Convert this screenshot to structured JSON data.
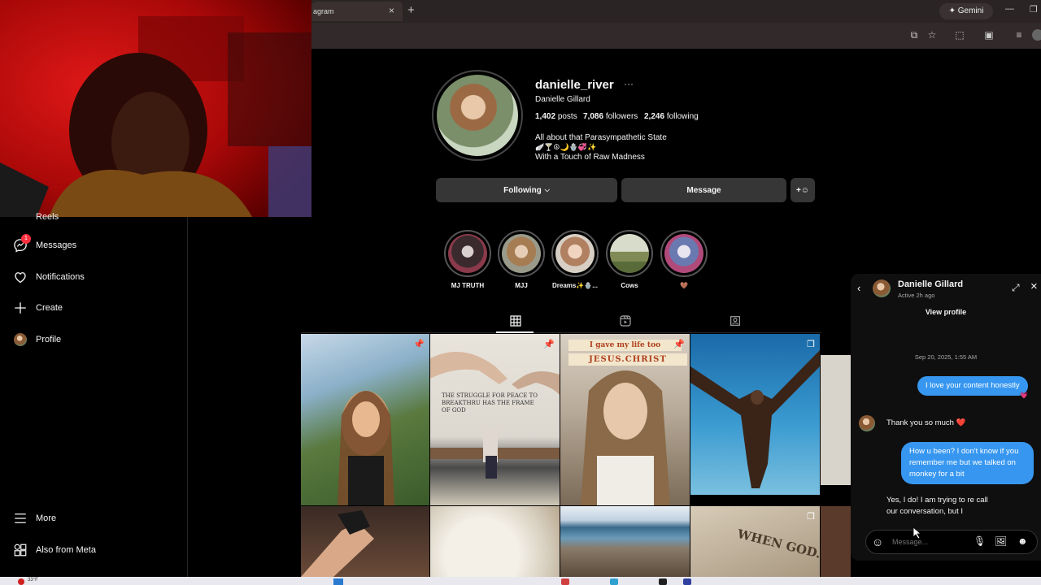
{
  "browser": {
    "tab_title": "agram",
    "gemini_label": "Gemini",
    "close_glyph": "×",
    "new_tab_glyph": "+"
  },
  "sidebar": {
    "partial_item": "Reels",
    "items": [
      {
        "label": "Messages",
        "icon": "messenger-icon",
        "badge": "1"
      },
      {
        "label": "Notifications",
        "icon": "heart-icon"
      },
      {
        "label": "Create",
        "icon": "plus-icon"
      },
      {
        "label": "Profile",
        "icon": "avatar"
      }
    ],
    "bottom": [
      {
        "label": "More",
        "icon": "hamburger-icon"
      },
      {
        "label": "Also from Meta",
        "icon": "meta-grid-icon"
      }
    ]
  },
  "profile": {
    "username": "danielle_river",
    "more": "···",
    "full_name": "Danielle Gillard",
    "posts_count": "1,402",
    "posts_label": "posts",
    "followers_count": "7,086",
    "followers_label": "followers",
    "following_count": "2,246",
    "following_label": "following",
    "bio_line1": "All about that Parasympathetic State",
    "bio_line2": "🪽🍸☮🌙🪬💞✨",
    "bio_line3": "With a Touch of Raw Madness",
    "following_button": "Following",
    "message_button": "Message"
  },
  "highlights": [
    {
      "label": "MJ TRUTH"
    },
    {
      "label": "MJJ"
    },
    {
      "label": "Dreams✨🪬..."
    },
    {
      "label": "Cows"
    },
    {
      "label": "🤎"
    }
  ],
  "posts": [
    {
      "caption": ""
    },
    {
      "caption": "THE STRUGGLE FOR PEACE TO BREAKTHRU HAS THE FRAME OF GOD"
    },
    {
      "caption_line1": "I gave my life too",
      "caption_line2": "JESUS.CHRIST"
    },
    {
      "caption": ""
    },
    {
      "caption": ""
    },
    {
      "caption": ""
    },
    {
      "caption": ""
    },
    {
      "caption": "WHEN GOD... A WOMAN"
    }
  ],
  "dm": {
    "name": "Danielle Gillard",
    "status": "Active 2h ago",
    "view_profile": "View profile",
    "timestamp": "Sep 20, 2025, 1:55 AM",
    "messages": [
      {
        "from": "me",
        "text": "I love your content honestly"
      },
      {
        "from": "them",
        "text": "Thank you so much ❤️"
      },
      {
        "from": "me",
        "text": "How u been? I don't know if you remember me but we talked on monkey for a bit"
      },
      {
        "from": "them",
        "text": "Yes, I do! I am trying to re call our conversation, but I"
      }
    ],
    "placeholder": "Message..."
  },
  "taskbar": {
    "temp": "33°F"
  }
}
